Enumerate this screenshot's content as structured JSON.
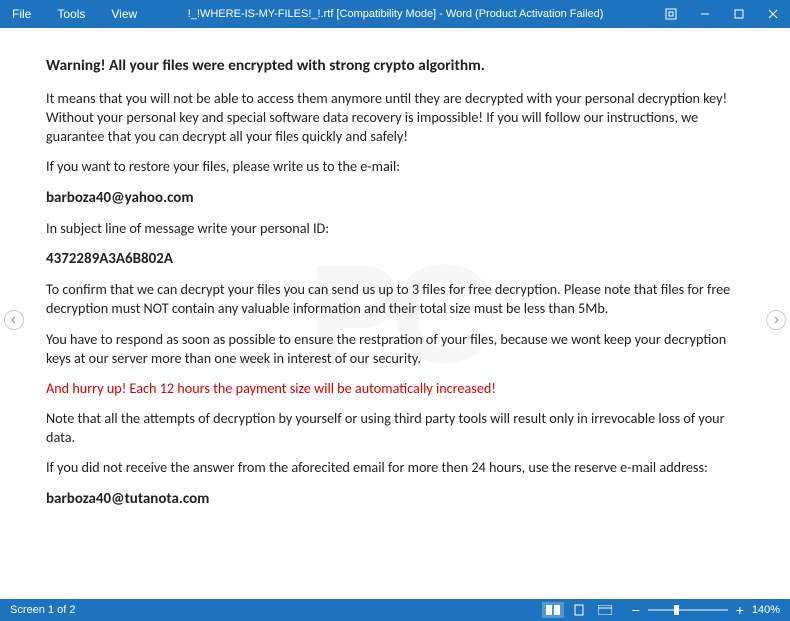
{
  "titlebar": {
    "menu": {
      "file": "File",
      "tools": "Tools",
      "view": "View"
    },
    "title": "!_!WHERE-IS-MY-FILES!_!.rtf [Compatibility Mode] - Word (Product Activation Failed)"
  },
  "document": {
    "heading": "Warning! All your files were encrypted with strong crypto algorithm.",
    "p1": "It means that you will not be able to access them anymore until they are decrypted with your personal decryption key! Without your personal key and special software data recovery is impossible! If you will follow our instructions, we guarantee that you can decrypt all your files quickly and safely!",
    "p2": "If you want to restore your files, please write us to the e-mail:",
    "email1": "barboza40@yahoo.com",
    "p3": "In subject line of message write your personal ID:",
    "id": "4372289A3A6B802A",
    "p4": "To confirm that we can decrypt your files you can send us up to 3 files for free decryption. Please note that files for free decryption must NOT contain any valuable information and their total size must be less than 5Mb.",
    "p5": "You have to respond as soon as possible to ensure the restpration of your files, because we wont keep your decryption keys at our server more than one week in interest of our security.",
    "p6": "And hurry up! Each 12 hours the payment size will be automatically increased!",
    "p7": "Note that all the attempts of decryption by yourself or using third party tools will result only in irrevocable loss of your data.",
    "p8": "If you did not receive the answer from the aforecited email for more then 24 hours, use the reserve e-mail address:",
    "email2": "barboza40@tutanota.com"
  },
  "statusbar": {
    "screen": "Screen 1 of 2",
    "zoom": "140%"
  }
}
